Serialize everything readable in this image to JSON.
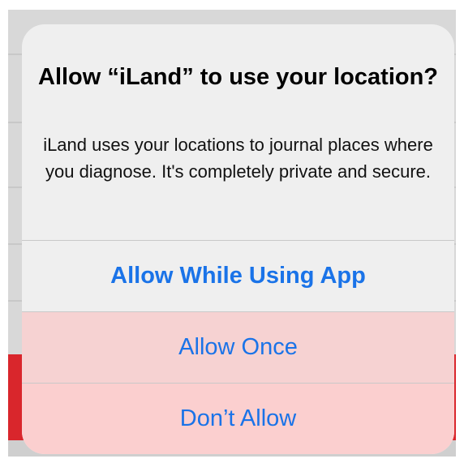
{
  "alert": {
    "title": "Allow “iLand” to use your location?",
    "message": "iLand uses your locations to journal places where you diagnose. It's completely private and secure.",
    "buttons": {
      "allow_while_using": "Allow While Using App",
      "allow_once": "Allow Once",
      "dont_allow": "Don’t Allow"
    }
  },
  "colors": {
    "button_text": "#1a73e8",
    "background_red": "#d9262c"
  }
}
